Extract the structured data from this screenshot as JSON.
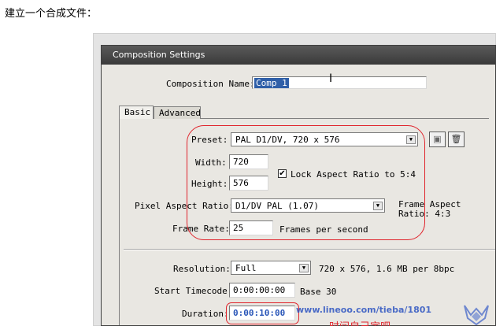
{
  "caption": "建立一个合成文件：",
  "dialog": {
    "title": "Composition Settings",
    "comp_name_label": "Composition Name:",
    "comp_name_value": "Comp 1",
    "tabs": [
      {
        "label": "Basic",
        "active": true
      },
      {
        "label": "Advanced",
        "active": false
      }
    ],
    "preset": {
      "label": "Preset:",
      "value": "PAL D1/DV, 720 x 576",
      "save_icon": "floppy-disk-icon",
      "delete_icon": "trash-icon"
    },
    "width": {
      "label": "Width:",
      "value": "720"
    },
    "height": {
      "label": "Height:",
      "value": "576"
    },
    "lock_aspect": {
      "label": "Lock Aspect Ratio to 5:4",
      "checked": true
    },
    "pixel_aspect": {
      "label": "Pixel Aspect Ratio:",
      "value": "D1/DV PAL (1.07)",
      "frame_aspect_label": "Frame Aspect",
      "frame_aspect_value": "Ratio: 4:3"
    },
    "frame_rate": {
      "label": "Frame Rate:",
      "value": "25",
      "unit": "Frames per second"
    },
    "resolution": {
      "label": "Resolution:",
      "value": "Full",
      "info": "720 x 576, 1.6 MB per 8bpc"
    },
    "start_timecode": {
      "label": "Start Timecode:",
      "value": "0:00:00:00",
      "base": "Base 30"
    },
    "duration": {
      "label": "Duration:",
      "value": "0:00:10:00"
    }
  },
  "overlay": {
    "watermark": "www.lineoo.com/tieba/1801",
    "note": "时间自己定吧",
    "annotation_color": "#e0242c",
    "accent": "#2f5fa8"
  }
}
